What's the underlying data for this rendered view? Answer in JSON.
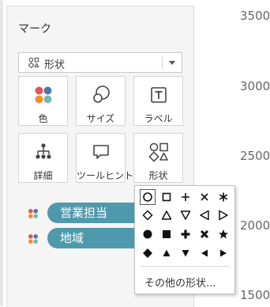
{
  "marks_card": {
    "title": "マーク",
    "mark_type": {
      "label": "形状",
      "icon": "shapes-icon"
    },
    "tiles": [
      {
        "label": "色",
        "icon": "color-icon"
      },
      {
        "label": "サイズ",
        "icon": "size-icon"
      },
      {
        "label": "ラベル",
        "icon": "label-icon"
      },
      {
        "label": "詳細",
        "icon": "detail-icon"
      },
      {
        "label": "ツールヒント",
        "icon": "tooltip-icon"
      },
      {
        "label": "形状",
        "icon": "shapes-icon"
      }
    ],
    "pills": [
      {
        "label": "営業担当",
        "icon": "color-icon"
      },
      {
        "label": "地域",
        "icon": "color-icon"
      }
    ]
  },
  "axis": {
    "ticks": [
      "3500",
      "3000",
      "2500",
      "2000",
      "1500"
    ]
  },
  "shape_palette": {
    "selected": "circle-outline",
    "more_label": "その他の形状...",
    "shapes": [
      "circle-outline",
      "square-outline",
      "plus",
      "times",
      "asterisk",
      "diamond-outline",
      "triangle-up-outline",
      "triangle-down-outline",
      "triangle-left-outline",
      "triangle-right-outline",
      "circle-filled",
      "square-filled",
      "plus-bold",
      "times-bold",
      "star-filled",
      "diamond-filled",
      "triangle-up-filled",
      "triangle-down-filled",
      "triangle-left-filled",
      "triangle-right-filled"
    ]
  },
  "colors": {
    "pill": "#4e9aac",
    "dot_red": "#e15759",
    "dot_blue": "#4e79a7",
    "dot_orange": "#f28e2b",
    "dot_teal": "#76b7b2"
  }
}
